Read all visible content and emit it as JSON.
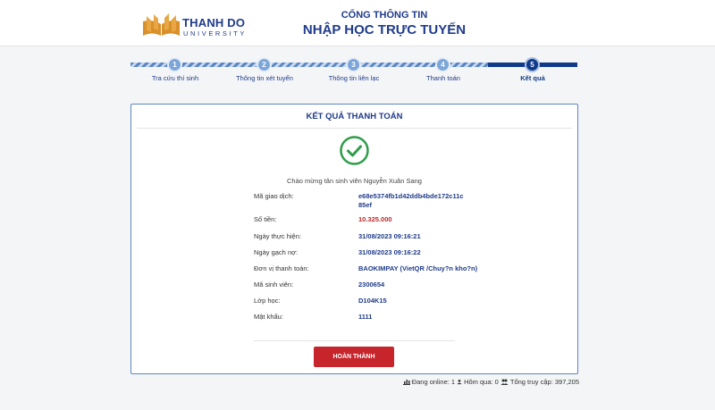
{
  "header": {
    "logo_title": "THANH DO",
    "logo_sub": "UNIVERSITY",
    "portal_small": "CỔNG THÔNG TIN",
    "portal_big": "NHẬP HỌC TRỰC TUYẾN",
    "brand_color": "#1f3b8a",
    "logo_color": "#d9902a"
  },
  "steps": [
    {
      "number": "1",
      "label": "Tra cứu thí sinh",
      "active": false
    },
    {
      "number": "2",
      "label": "Thông tin xét tuyển",
      "active": false
    },
    {
      "number": "3",
      "label": "Thông tin liên lạc",
      "active": false
    },
    {
      "number": "4",
      "label": "Thanh toán",
      "active": false
    },
    {
      "number": "5",
      "label": "Kết quả",
      "active": true
    }
  ],
  "result": {
    "title": "KẾT QUẢ THANH TOÁN",
    "status_icon": "check-circle-icon",
    "welcome": "Chào mừng tân sinh viên Nguyễn Xuân Sang",
    "fields": [
      {
        "label": "Mã giao dịch:",
        "value": "e68e5374fb1d42ddb4bde172c11c85ef"
      },
      {
        "label": "Số tiền:",
        "value": "10.325.000"
      },
      {
        "label": "Ngày thực hiện:",
        "value": "31/08/2023 09:16:21"
      },
      {
        "label": "Ngày gạch nợ:",
        "value": "31/08/2023 09:16:22"
      },
      {
        "label": "Đơn vị thanh toán:",
        "value": "BAOKIMPAY (VietQR /Chuy?n kho?n)"
      },
      {
        "label": "Mã sinh viên:",
        "value": "2300654"
      },
      {
        "label": "Lớp học:",
        "value": "D104K15"
      },
      {
        "label": "Mật khẩu:",
        "value": "1111"
      }
    ],
    "button_label": "HOÀN THÀNH",
    "success_color": "#2e9d4a",
    "button_color": "#c7252c"
  },
  "footer": {
    "online": "Đang online: 1",
    "today": "Hôm qua: 0",
    "total": "Tổng truy cập: 397,205"
  }
}
